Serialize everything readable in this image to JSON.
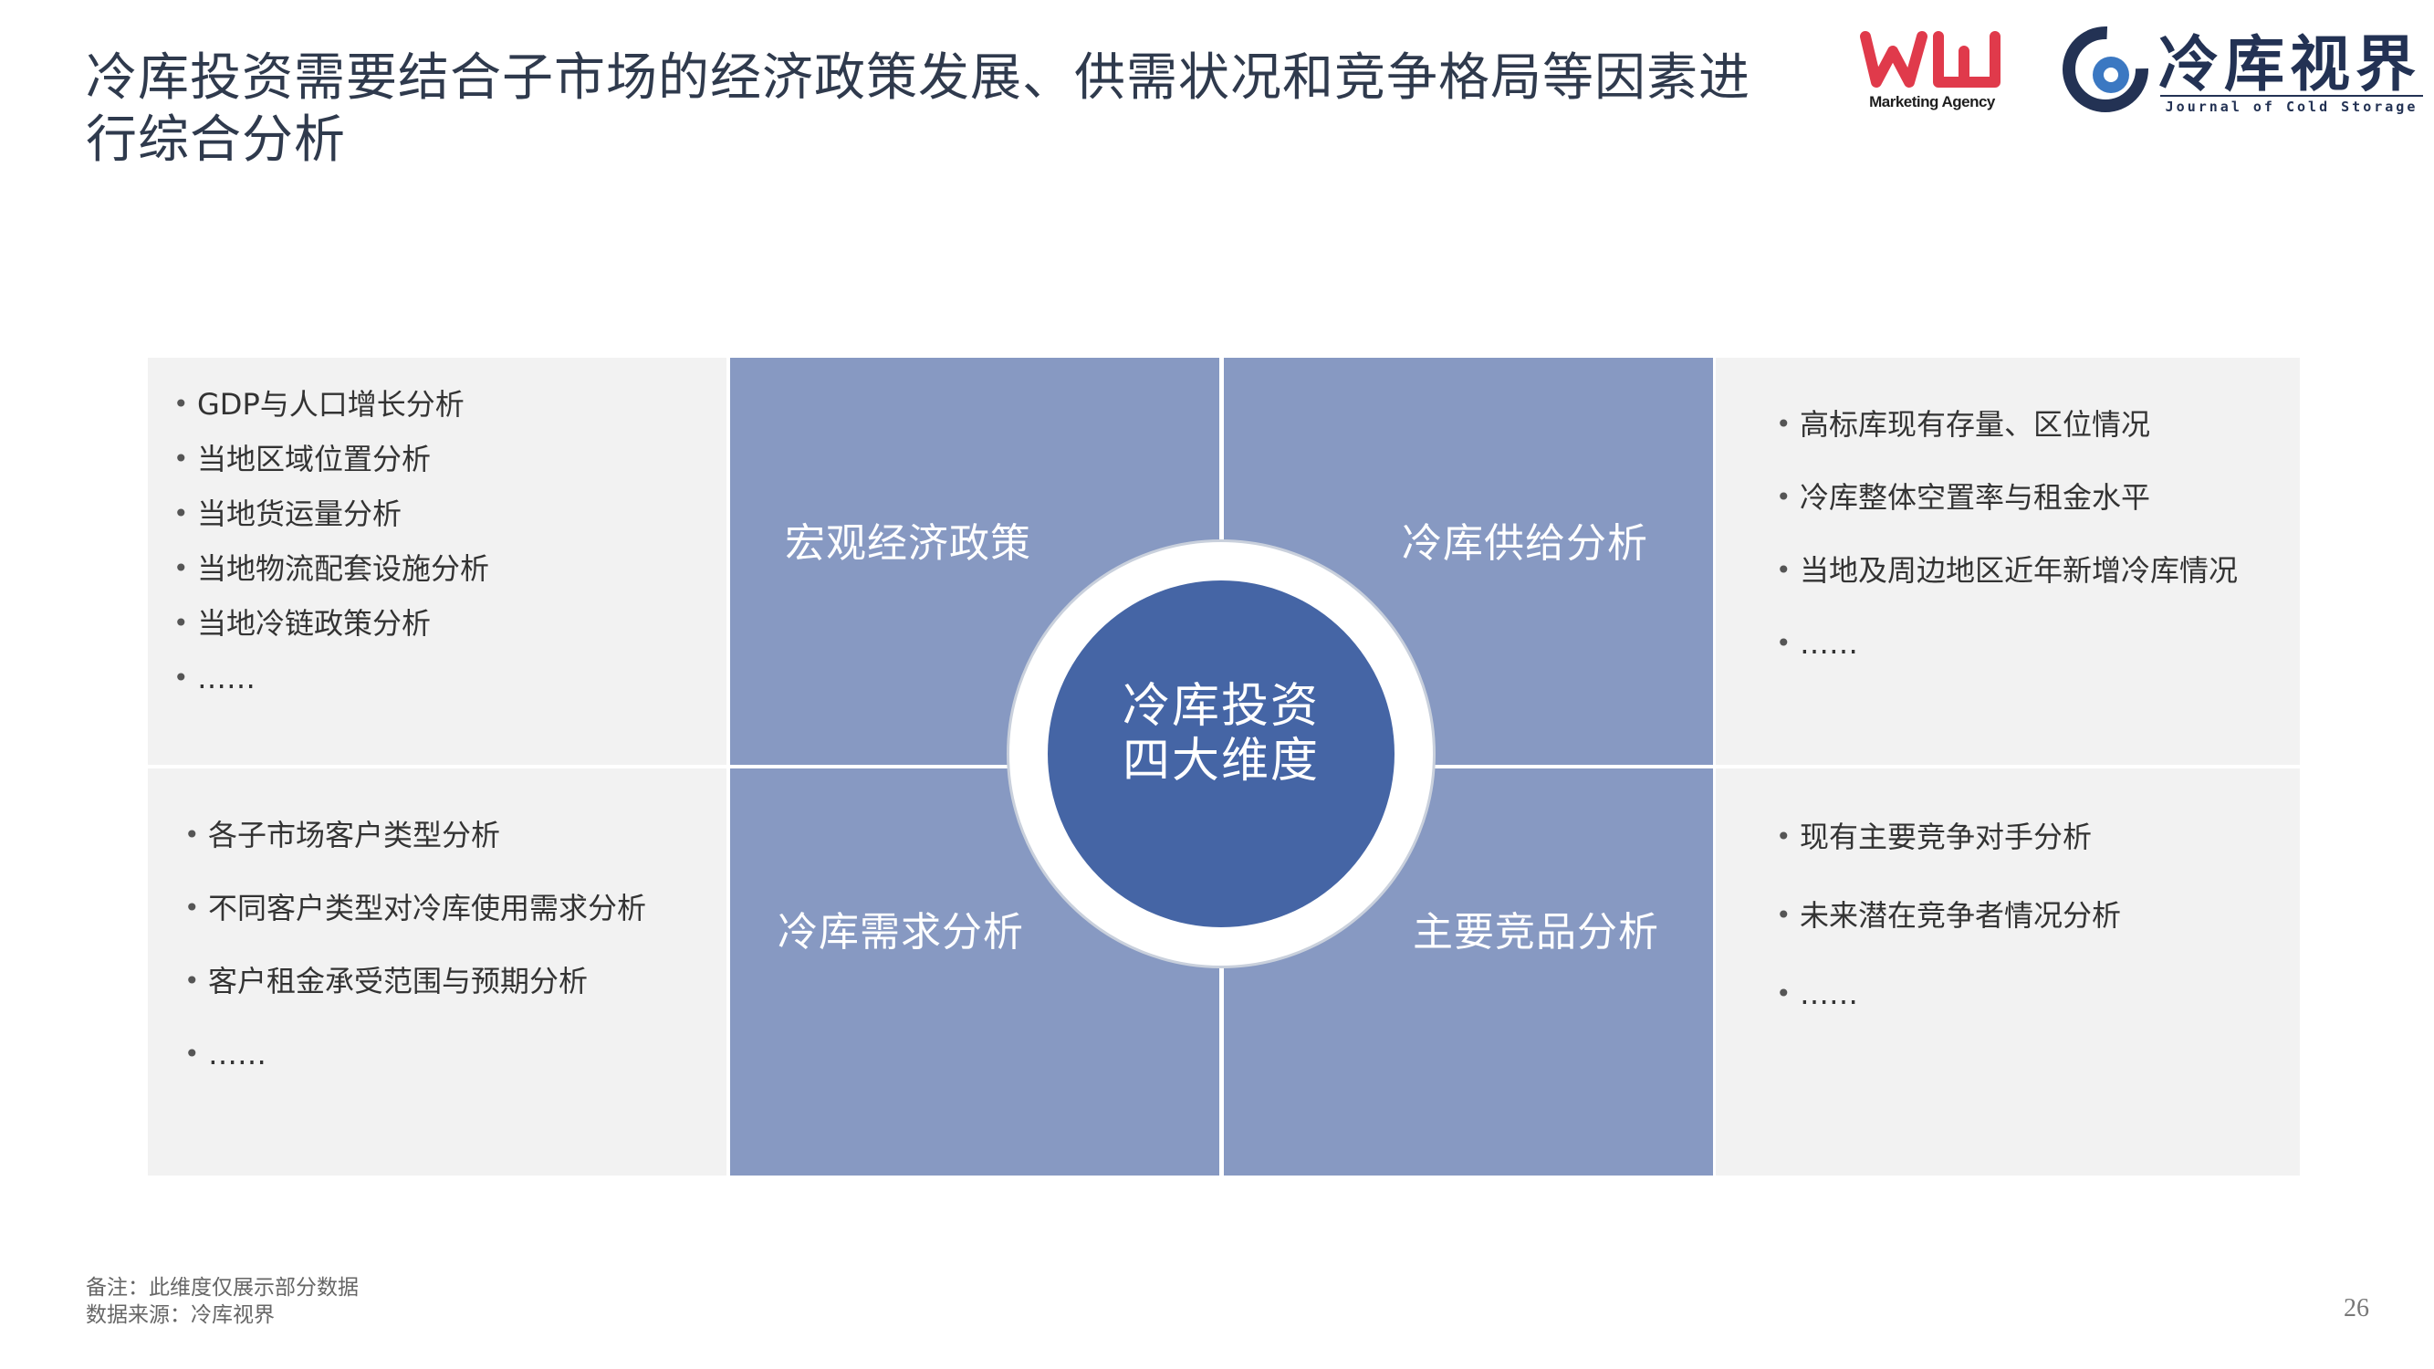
{
  "title": "冷库投资需要结合子市场的经济政策发展、供需状况和竞争格局等因素进行综合分析",
  "logos": {
    "wj_caption": "Marketing Agency",
    "jcs_cn": "冷库视界",
    "jcs_en": "Journal of Cold Storage"
  },
  "diagram": {
    "center": [
      "冷库投资",
      "四大维度"
    ],
    "quadrants": {
      "top_left": "宏观经济政策",
      "top_right": "冷库供给分析",
      "bottom_left": "冷库需求分析",
      "bottom_right": "主要竞品分析"
    },
    "top_left_items": [
      "GDP与人口增长分析",
      "当地区域位置分析",
      "当地货运量分析",
      "当地物流配套设施分析",
      "当地冷链政策分析",
      "……"
    ],
    "top_right_items": [
      "高标库现有存量、区位情况",
      "冷库整体空置率与租金水平",
      "当地及周边地区近年新增冷库情况",
      "……"
    ],
    "bottom_left_items": [
      "各子市场客户类型分析",
      "不同客户类型对冷库使用需求分析",
      "客户租金承受范围与预期分析",
      "……"
    ],
    "bottom_right_items": [
      "现有主要竞争对手分析",
      "未来潜在竞争者情况分析",
      "……"
    ],
    "bullet": "•"
  },
  "footer": {
    "note": "备注：此维度仅展示部分数据",
    "source": "数据来源：冷库视界",
    "page": "26"
  },
  "colors": {
    "quadrant": "#8799c2",
    "center": "#4565a5",
    "panel": "#f2f2f2",
    "wj_logo": "#e03a4b",
    "jcs_logo": "#233254"
  }
}
